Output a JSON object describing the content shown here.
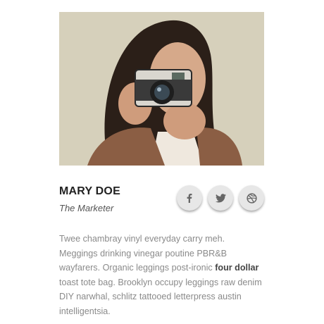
{
  "profile": {
    "name": "MARY DOE",
    "role": "The Marketer"
  },
  "socials": [
    {
      "name": "facebook",
      "icon": "facebook-icon"
    },
    {
      "name": "twitter",
      "icon": "twitter-icon"
    },
    {
      "name": "dribbble",
      "icon": "dribbble-icon"
    }
  ],
  "bio": {
    "before": "Twee chambray vinyl everyday carry meh. Meggings drinking vinegar poutine PBR&B wayfarers. Organic leggings post-ironic ",
    "bold": "four dollar",
    "after": " toast tote bag. Brooklyn occupy leggings raw denim DIY narwhal, schlitz tattooed letterpress austin intelligentsia."
  },
  "colors": {
    "icon": "#666666",
    "button_bg": "#e7e7e7",
    "bio_text": "#8a8a8a"
  }
}
